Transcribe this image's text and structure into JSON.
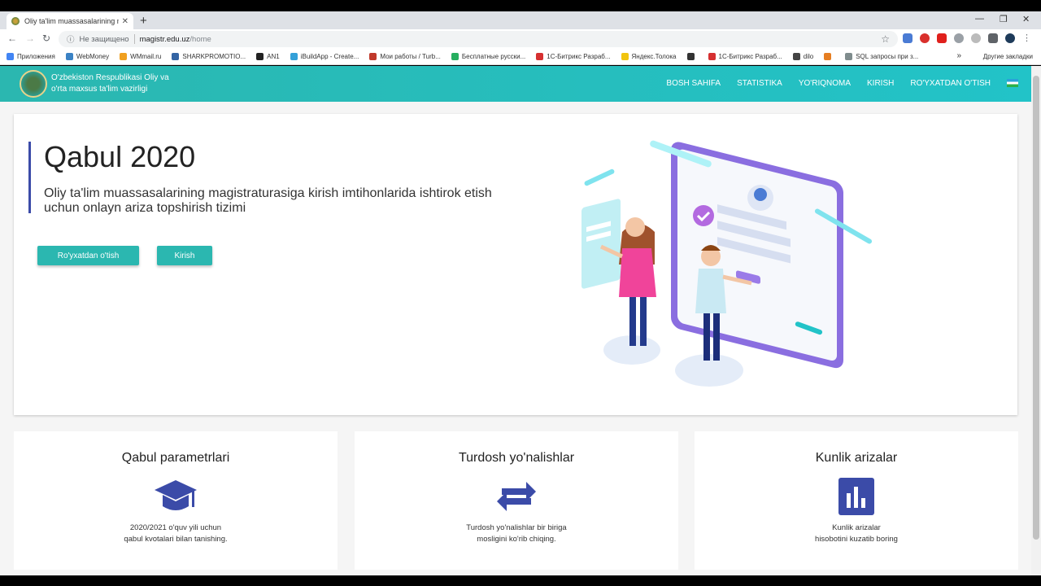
{
  "browser": {
    "tab_title": "Oliy ta'lim muassasalarining mag",
    "insecure_label": "Не защищено",
    "url_host": "magistr.edu.uz",
    "url_path": "/home",
    "bookmarks": [
      {
        "label": "Приложения",
        "color": "#4285f4"
      },
      {
        "label": "WebMoney",
        "color": "#3b82c4"
      },
      {
        "label": "WMmail.ru",
        "color": "#f0a020"
      },
      {
        "label": "SHARKPROMOTIO...",
        "color": "#3465a4"
      },
      {
        "label": "AN1",
        "color": "#222222"
      },
      {
        "label": "iBuildApp - Create...",
        "color": "#34a0d8"
      },
      {
        "label": "Мои работы / Turb...",
        "color": "#c0392b"
      },
      {
        "label": "Бесплатные русски...",
        "color": "#27ae60"
      },
      {
        "label": "1С-Битрикс Разраб...",
        "color": "#d63031"
      },
      {
        "label": "Яндекс.Толока",
        "color": "#f1c40f"
      },
      {
        "label": "",
        "color": "#333333",
        "glyph": "W"
      },
      {
        "label": "1С-Битрикс Разраб...",
        "color": "#d63031"
      },
      {
        "label": "dilo",
        "color": "#444444"
      },
      {
        "label": "",
        "color": "#e67e22"
      },
      {
        "label": "SQL запросы при з...",
        "color": "#7f8c8d"
      }
    ],
    "other_bookmarks": "Другие закладки"
  },
  "site": {
    "org_line1": "O'zbekiston Respublikasi Oliy va",
    "org_line2": "o'rta maxsus ta'lim vazirligi",
    "menu": [
      "BOSH SAHIFA",
      "STATISTIKA",
      "YO'RIQNOMA",
      "KIRISH",
      "RO'YXATDAN O'TISH"
    ]
  },
  "hero": {
    "title": "Qabul 2020",
    "subtitle": "Oliy ta'lim muassasalarining magistraturasiga kirish imtihonlarida ishtirok etish uchun onlayn ariza topshirish tizimi",
    "register_label": "Ro'yxatdan o'tish",
    "login_label": "Kirish"
  },
  "cards": [
    {
      "title": "Qabul parametrlari",
      "line1": "2020/2021 o'quv yili uchun",
      "line2": "qabul kvotalari bilan tanishing.",
      "icon": "graduation-cap-icon"
    },
    {
      "title": "Turdosh yo'nalishlar",
      "line1": "Turdosh yo'nalishlar bir biriga",
      "line2": "mosligini ko'rib chiqing.",
      "icon": "swap-arrows-icon"
    },
    {
      "title": "Kunlik arizalar",
      "line1": "Kunlik arizalar",
      "line2": "hisobotini kuzatib boring",
      "icon": "bar-chart-icon"
    }
  ],
  "colors": {
    "accent": "#2bb7b0",
    "icon_blue": "#3b4ba8"
  }
}
